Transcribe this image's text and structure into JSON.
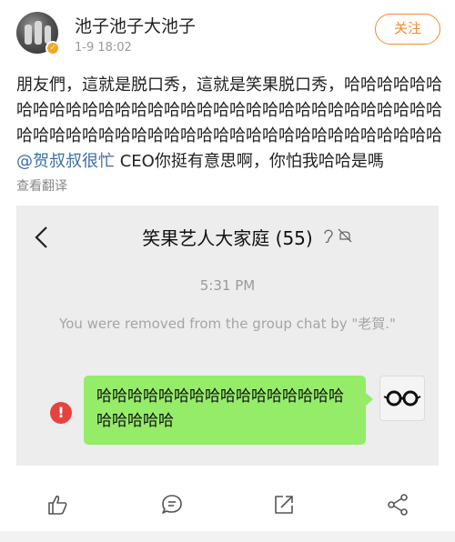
{
  "post": {
    "username": "池子池子大池子",
    "timestamp": "1-9 18:02",
    "follow_label": "关注",
    "text_before": "朋友們，這就是脱口秀，這就是笑果脱口秀，哈哈哈哈哈哈哈哈哈哈哈哈哈哈哈哈哈哈哈哈哈哈哈哈哈哈哈哈哈哈哈哈哈哈哈哈哈哈哈哈哈哈哈哈哈哈哈哈哈哈哈哈哈哈哈哈哈哈",
    "mention": "@贺叔叔很忙",
    "text_after": " CEO你挺有意思啊，你怕我哈哈是嗎",
    "translate_label": "查看翻译"
  },
  "screenshot": {
    "chat_title": "笑果艺人大家庭 (55)",
    "time": "5:31 PM",
    "system_message": "You were removed from the group chat by \"老賀.\"",
    "error_mark": "!",
    "bubble_text": "哈哈哈哈哈哈哈哈哈哈哈哈哈哈哈哈哈哈哈哈哈"
  },
  "icons": {
    "back": "chevron-left-icon",
    "ear": "ear-icon",
    "mute": "bell-muted-icon",
    "like": "thumbs-up-icon",
    "comment": "comment-icon",
    "repost": "repost-icon",
    "share": "share-icon"
  },
  "colors": {
    "accent": "#f08d2c",
    "mention": "#3b6ea5",
    "bubble": "#95ec69",
    "error": "#e64340",
    "verified": "#f5a623"
  }
}
